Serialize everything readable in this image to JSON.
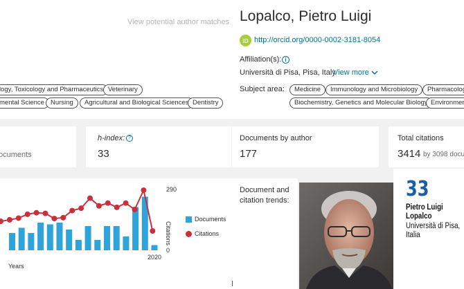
{
  "profile": {
    "view_matches": "View potential author matches",
    "name": "Lopalco, Pietro Luigi",
    "orcid_icon": "iD",
    "orcid_url": "http://orcid.org/0000-0002-3181-8054",
    "affiliation_label": "Affiliation(s):",
    "affiliation_value": "Università di Pisa, Pisa, Italy",
    "view_more": "View more",
    "subject_label": "Subject area:",
    "subjects_left_row1": [
      "logy, Toxicology and Pharmaceutics",
      "Veterinary"
    ],
    "subjects_left_row2": [
      "mental Science",
      "Nursing",
      "Agricultural and Biological Sciences",
      "Dentistry"
    ],
    "subjects_right_row1": [
      "Medicine",
      "Immunology and Microbiology",
      "Pharmacolog"
    ],
    "subjects_right_row2": [
      "Biochemistry, Genetics and Molecular Biology",
      "Environmen"
    ]
  },
  "metrics": {
    "documents_partial": "ocuments",
    "h_index_label": "h-index:",
    "h_index_value": "33",
    "docs_by_author_label": "Documents by author",
    "docs_by_author_value": "177",
    "total_citations_label": "Total citations",
    "total_citations_value": "3414",
    "total_citations_sub": "by 3098 docu"
  },
  "trends": {
    "label": "Document and citation trends:"
  },
  "overlay": {
    "number": "33",
    "name": "Pietro Luigi Lopalco",
    "affiliation": "Università di Pisa, Italia"
  },
  "chart_data": {
    "type": "bar",
    "ylim": [
      0,
      290
    ],
    "y_right_ticks": [
      "290",
      "0"
    ],
    "y_right_label": "Citations",
    "xlabel": "Years",
    "last_year_label": "2020",
    "legend": [
      "Documents",
      "Citations"
    ],
    "colors": {
      "documents": "#2fa4db",
      "citations": "#c8303c"
    },
    "series": [
      {
        "name": "Documents",
        "values": [
          10,
          13,
          10,
          16,
          15,
          16,
          12,
          6,
          14,
          6,
          14,
          14,
          8,
          25,
          31,
          3
        ]
      },
      {
        "name": "Citations",
        "values": [
          135,
          142,
          150,
          168,
          175,
          172,
          148,
          152,
          185,
          196,
          243,
          207,
          220,
          200,
          220,
          190,
          280,
          90
        ]
      }
    ]
  }
}
